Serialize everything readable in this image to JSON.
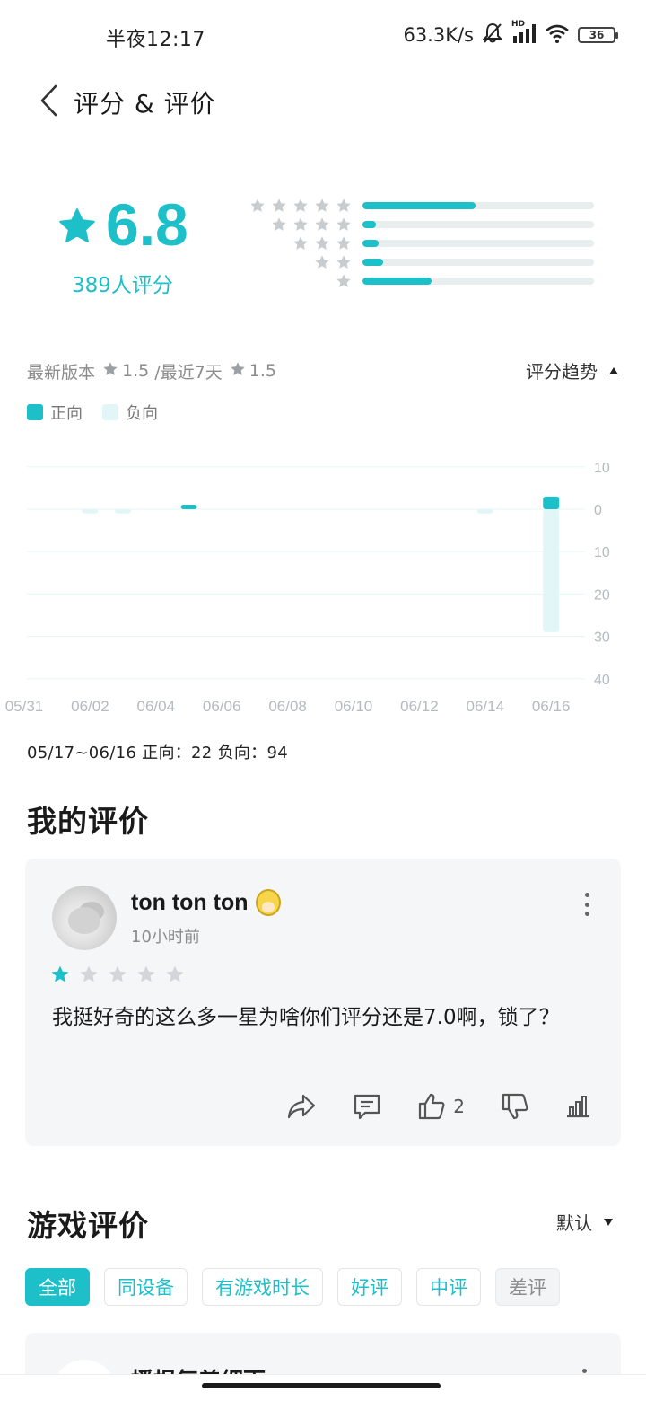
{
  "status_bar": {
    "time": "半夜12:17",
    "net_speed": "63.3K/s",
    "network_label": "HD",
    "battery": "36"
  },
  "header": {
    "title": "评分 & 评价"
  },
  "rating_summary": {
    "score": "6.8",
    "count_text": "389人评分",
    "distribution": [
      {
        "stars": 5,
        "fraction": 0.49
      },
      {
        "stars": 4,
        "fraction": 0.06
      },
      {
        "stars": 3,
        "fraction": 0.07
      },
      {
        "stars": 2,
        "fraction": 0.09
      },
      {
        "stars": 1,
        "fraction": 0.3
      }
    ]
  },
  "version_row": {
    "latest_label": "最新版本",
    "latest_score": "1.5",
    "recent_label": "/最近7天",
    "recent_score": "1.5",
    "trend_label": "评分趋势"
  },
  "legend": {
    "positive": "正向",
    "negative": "负向"
  },
  "chart_data": {
    "type": "bar",
    "x_tick_labels": [
      "05/31",
      "06/02",
      "06/04",
      "06/06",
      "06/08",
      "06/10",
      "06/12",
      "06/14",
      "06/16"
    ],
    "y_tick_labels": [
      "10",
      "0",
      "10",
      "20",
      "30",
      "40"
    ],
    "ylim": [
      -40,
      10
    ],
    "grid": true,
    "series": [
      {
        "name": "正向",
        "points": [
          {
            "x": "06/04",
            "value": 1
          },
          {
            "x": "06/15",
            "value": 3
          }
        ]
      },
      {
        "name": "负向",
        "points": [
          {
            "x": "06/01",
            "value": 1
          },
          {
            "x": "06/02",
            "value": 1
          },
          {
            "x": "06/13",
            "value": 1
          },
          {
            "x": "06/15",
            "value": 29
          }
        ]
      }
    ],
    "colors": {
      "positive": "#1dbfc9",
      "negative": "#e2f6f8"
    }
  },
  "range_summary": {
    "text": "05/17~06/16  正向：22   负向：94"
  },
  "my_review": {
    "section_title": "我的评价",
    "username": "ton ton ton",
    "time": "10小时前",
    "rating": 1,
    "text": "我挺好奇的这么多一星为啥你们评分还是7.0啊，锁了？",
    "likes": "2"
  },
  "game_reviews": {
    "section_title": "游戏评价",
    "sort_label": "默认",
    "filters": [
      "全部",
      "同设备",
      "有游戏时长",
      "好评",
      "中评",
      "差评"
    ],
    "active_filter": "全部",
    "next_username": "播报每差细雨"
  },
  "colors": {
    "accent": "#1dbfc9",
    "card_bg": "#f5f6f7",
    "star_gray": "#c8cccf"
  }
}
